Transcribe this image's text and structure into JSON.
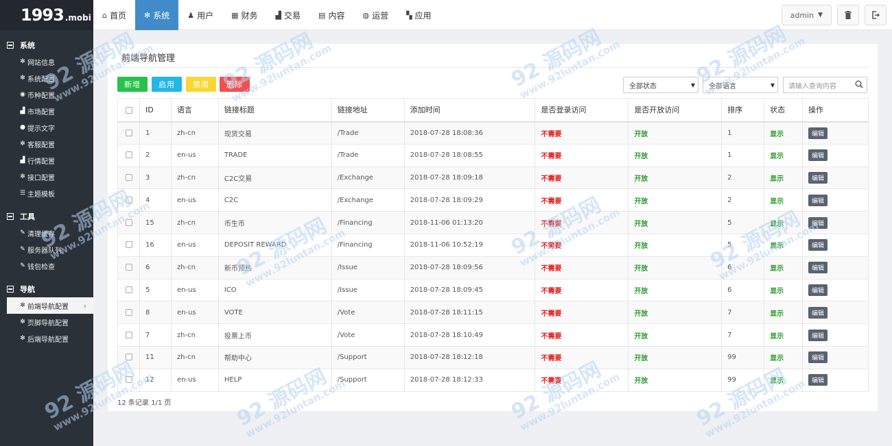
{
  "logo": {
    "main": "1993",
    "suffix": ".mobi"
  },
  "sidebar": {
    "groups": [
      {
        "title": "系统",
        "items": [
          {
            "icon": "gear-icon",
            "glyph": "✻",
            "label": "网站信息"
          },
          {
            "icon": "gear-icon",
            "glyph": "✻",
            "label": "系统配置"
          },
          {
            "icon": "coin-icon",
            "glyph": "◉",
            "label": "币种配置"
          },
          {
            "icon": "bar-chart-icon",
            "glyph": "▟",
            "label": "市场配置"
          },
          {
            "icon": "info-icon",
            "glyph": "●",
            "label": "提示文字"
          },
          {
            "icon": "gear-icon",
            "glyph": "✻",
            "label": "客服配置"
          },
          {
            "icon": "bar-chart-icon",
            "glyph": "▟",
            "label": "行情配置"
          },
          {
            "icon": "gear-icon",
            "glyph": "✻",
            "label": "接口配置"
          },
          {
            "icon": "list-icon",
            "glyph": "☰",
            "label": "主题模板"
          }
        ]
      },
      {
        "title": "工具",
        "items": [
          {
            "icon": "wrench-icon",
            "glyph": "✎",
            "label": "清理缓存"
          },
          {
            "icon": "wrench-icon",
            "glyph": "✎",
            "label": "服务器队列"
          },
          {
            "icon": "wrench-icon",
            "glyph": "✎",
            "label": "钱包检查"
          }
        ]
      },
      {
        "title": "导航",
        "items": [
          {
            "icon": "gear-icon",
            "glyph": "✻",
            "label": "前端导航配置",
            "active": true
          },
          {
            "icon": "gear-icon",
            "glyph": "✻",
            "label": "页脚导航配置"
          },
          {
            "icon": "gear-icon",
            "glyph": "✻",
            "label": "后端导航配置"
          }
        ]
      }
    ]
  },
  "topnav": {
    "tabs": [
      {
        "icon": "home-icon",
        "glyph": "⌂",
        "label": "首页"
      },
      {
        "icon": "gear-icon",
        "glyph": "✻",
        "label": "系统",
        "active": true
      },
      {
        "icon": "user-icon",
        "glyph": "♟",
        "label": "用户"
      },
      {
        "icon": "table-icon",
        "glyph": "▦",
        "label": "财务"
      },
      {
        "icon": "bar-chart-icon",
        "glyph": "▟",
        "label": "交易"
      },
      {
        "icon": "document-icon",
        "glyph": "▤",
        "label": "内容"
      },
      {
        "icon": "globe-icon",
        "glyph": "◍",
        "label": "运营"
      },
      {
        "icon": "grid-icon",
        "glyph": "▚",
        "label": "应用"
      }
    ],
    "user": "admin"
  },
  "panel": {
    "title": "前端导航管理"
  },
  "toolbar": {
    "add_label": "新增",
    "enable_label": "启用",
    "disable_label": "禁用",
    "delete_label": "删除",
    "status_select": "全部状态",
    "lang_select": "全部语言",
    "search_placeholder": "请输入查询内容"
  },
  "table": {
    "headers": [
      "ID",
      "语言",
      "链接标题",
      "链接地址",
      "添加时间",
      "是否登录访问",
      "是否开放访问",
      "排序",
      "状态",
      "操作"
    ],
    "edit_label": "编辑",
    "rows": [
      {
        "id": "1",
        "lang": "zh-cn",
        "title": "现货交易",
        "url": "/Trade",
        "time": "2018-07-28 18:08:36",
        "login": "不需要",
        "open": "开放",
        "sort": "1",
        "status": "显示"
      },
      {
        "id": "2",
        "lang": "en-us",
        "title": "TRADE",
        "url": "/Trade",
        "time": "2018-07-28 18:08:55",
        "login": "不需要",
        "open": "开放",
        "sort": "1",
        "status": "显示"
      },
      {
        "id": "3",
        "lang": "zh-cn",
        "title": "C2C交易",
        "url": "/Exchange",
        "time": "2018-07-28 18:09:18",
        "login": "不需要",
        "open": "开放",
        "sort": "2",
        "status": "显示"
      },
      {
        "id": "4",
        "lang": "en-us",
        "title": "C2C",
        "url": "/Exchange",
        "time": "2018-07-28 18:09:29",
        "login": "不需要",
        "open": "开放",
        "sort": "2",
        "status": "显示"
      },
      {
        "id": "15",
        "lang": "zh-cn",
        "title": "币生币",
        "url": "/Financing",
        "time": "2018-11-06 01:13:20",
        "login": "不需要",
        "open": "开放",
        "sort": "5",
        "status": "显示"
      },
      {
        "id": "16",
        "lang": "en-us",
        "title": "DEPOSIT REWARD",
        "url": "/Financing",
        "time": "2018-11-06 10:52:19",
        "login": "不需要",
        "open": "开放",
        "sort": "5",
        "status": "显示"
      },
      {
        "id": "6",
        "lang": "zh-cn",
        "title": "新币预热",
        "url": "/Issue",
        "time": "2018-07-28 18:09:56",
        "login": "不需要",
        "open": "开放",
        "sort": "6",
        "status": "显示"
      },
      {
        "id": "5",
        "lang": "en-us",
        "title": "ICO",
        "url": "/Issue",
        "time": "2018-07-28 18:09:45",
        "login": "不需要",
        "open": "开放",
        "sort": "6",
        "status": "显示"
      },
      {
        "id": "8",
        "lang": "en-us",
        "title": "VOTE",
        "url": "/Vote",
        "time": "2018-07-28 18:11:15",
        "login": "不需要",
        "open": "开放",
        "sort": "7",
        "status": "显示"
      },
      {
        "id": "7",
        "lang": "zh-cn",
        "title": "投票上币",
        "url": "/Vote",
        "time": "2018-07-28 18:10:49",
        "login": "不需要",
        "open": "开放",
        "sort": "7",
        "status": "显示"
      },
      {
        "id": "11",
        "lang": "zh-cn",
        "title": "帮助中心",
        "url": "/Support",
        "time": "2018-07-28 18:12:18",
        "login": "不需要",
        "open": "开放",
        "sort": "99",
        "status": "显示"
      },
      {
        "id": "12",
        "lang": "en-us",
        "title": "HELP",
        "url": "/Support",
        "time": "2018-07-28 18:12:33",
        "login": "不需要",
        "open": "开放",
        "sort": "99",
        "status": "显示"
      }
    ]
  },
  "pagination": {
    "text": "12 条记录 1/1 页"
  },
  "watermark": {
    "line1": "92 源码网",
    "line2": "www.92luntan.com"
  }
}
